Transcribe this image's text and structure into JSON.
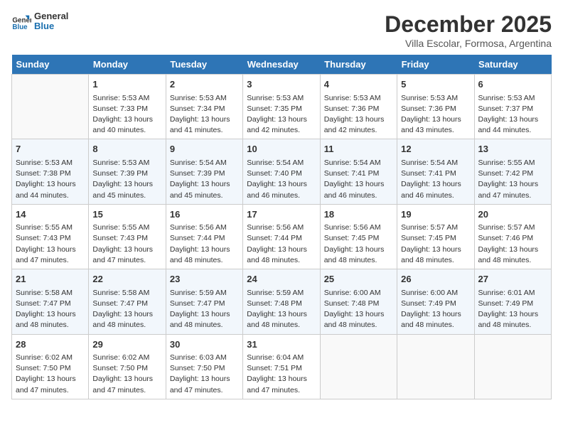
{
  "logo": {
    "text_general": "General",
    "text_blue": "Blue"
  },
  "title": "December 2025",
  "subtitle": "Villa Escolar, Formosa, Argentina",
  "days_of_week": [
    "Sunday",
    "Monday",
    "Tuesday",
    "Wednesday",
    "Thursday",
    "Friday",
    "Saturday"
  ],
  "weeks": [
    [
      {
        "day": "",
        "sunrise": "",
        "sunset": "",
        "daylight": ""
      },
      {
        "day": "1",
        "sunrise": "Sunrise: 5:53 AM",
        "sunset": "Sunset: 7:33 PM",
        "daylight": "Daylight: 13 hours and 40 minutes."
      },
      {
        "day": "2",
        "sunrise": "Sunrise: 5:53 AM",
        "sunset": "Sunset: 7:34 PM",
        "daylight": "Daylight: 13 hours and 41 minutes."
      },
      {
        "day": "3",
        "sunrise": "Sunrise: 5:53 AM",
        "sunset": "Sunset: 7:35 PM",
        "daylight": "Daylight: 13 hours and 42 minutes."
      },
      {
        "day": "4",
        "sunrise": "Sunrise: 5:53 AM",
        "sunset": "Sunset: 7:36 PM",
        "daylight": "Daylight: 13 hours and 42 minutes."
      },
      {
        "day": "5",
        "sunrise": "Sunrise: 5:53 AM",
        "sunset": "Sunset: 7:36 PM",
        "daylight": "Daylight: 13 hours and 43 minutes."
      },
      {
        "day": "6",
        "sunrise": "Sunrise: 5:53 AM",
        "sunset": "Sunset: 7:37 PM",
        "daylight": "Daylight: 13 hours and 44 minutes."
      }
    ],
    [
      {
        "day": "7",
        "sunrise": "Sunrise: 5:53 AM",
        "sunset": "Sunset: 7:38 PM",
        "daylight": "Daylight: 13 hours and 44 minutes."
      },
      {
        "day": "8",
        "sunrise": "Sunrise: 5:53 AM",
        "sunset": "Sunset: 7:39 PM",
        "daylight": "Daylight: 13 hours and 45 minutes."
      },
      {
        "day": "9",
        "sunrise": "Sunrise: 5:54 AM",
        "sunset": "Sunset: 7:39 PM",
        "daylight": "Daylight: 13 hours and 45 minutes."
      },
      {
        "day": "10",
        "sunrise": "Sunrise: 5:54 AM",
        "sunset": "Sunset: 7:40 PM",
        "daylight": "Daylight: 13 hours and 46 minutes."
      },
      {
        "day": "11",
        "sunrise": "Sunrise: 5:54 AM",
        "sunset": "Sunset: 7:41 PM",
        "daylight": "Daylight: 13 hours and 46 minutes."
      },
      {
        "day": "12",
        "sunrise": "Sunrise: 5:54 AM",
        "sunset": "Sunset: 7:41 PM",
        "daylight": "Daylight: 13 hours and 46 minutes."
      },
      {
        "day": "13",
        "sunrise": "Sunrise: 5:55 AM",
        "sunset": "Sunset: 7:42 PM",
        "daylight": "Daylight: 13 hours and 47 minutes."
      }
    ],
    [
      {
        "day": "14",
        "sunrise": "Sunrise: 5:55 AM",
        "sunset": "Sunset: 7:43 PM",
        "daylight": "Daylight: 13 hours and 47 minutes."
      },
      {
        "day": "15",
        "sunrise": "Sunrise: 5:55 AM",
        "sunset": "Sunset: 7:43 PM",
        "daylight": "Daylight: 13 hours and 47 minutes."
      },
      {
        "day": "16",
        "sunrise": "Sunrise: 5:56 AM",
        "sunset": "Sunset: 7:44 PM",
        "daylight": "Daylight: 13 hours and 48 minutes."
      },
      {
        "day": "17",
        "sunrise": "Sunrise: 5:56 AM",
        "sunset": "Sunset: 7:44 PM",
        "daylight": "Daylight: 13 hours and 48 minutes."
      },
      {
        "day": "18",
        "sunrise": "Sunrise: 5:56 AM",
        "sunset": "Sunset: 7:45 PM",
        "daylight": "Daylight: 13 hours and 48 minutes."
      },
      {
        "day": "19",
        "sunrise": "Sunrise: 5:57 AM",
        "sunset": "Sunset: 7:45 PM",
        "daylight": "Daylight: 13 hours and 48 minutes."
      },
      {
        "day": "20",
        "sunrise": "Sunrise: 5:57 AM",
        "sunset": "Sunset: 7:46 PM",
        "daylight": "Daylight: 13 hours and 48 minutes."
      }
    ],
    [
      {
        "day": "21",
        "sunrise": "Sunrise: 5:58 AM",
        "sunset": "Sunset: 7:47 PM",
        "daylight": "Daylight: 13 hours and 48 minutes."
      },
      {
        "day": "22",
        "sunrise": "Sunrise: 5:58 AM",
        "sunset": "Sunset: 7:47 PM",
        "daylight": "Daylight: 13 hours and 48 minutes."
      },
      {
        "day": "23",
        "sunrise": "Sunrise: 5:59 AM",
        "sunset": "Sunset: 7:47 PM",
        "daylight": "Daylight: 13 hours and 48 minutes."
      },
      {
        "day": "24",
        "sunrise": "Sunrise: 5:59 AM",
        "sunset": "Sunset: 7:48 PM",
        "daylight": "Daylight: 13 hours and 48 minutes."
      },
      {
        "day": "25",
        "sunrise": "Sunrise: 6:00 AM",
        "sunset": "Sunset: 7:48 PM",
        "daylight": "Daylight: 13 hours and 48 minutes."
      },
      {
        "day": "26",
        "sunrise": "Sunrise: 6:00 AM",
        "sunset": "Sunset: 7:49 PM",
        "daylight": "Daylight: 13 hours and 48 minutes."
      },
      {
        "day": "27",
        "sunrise": "Sunrise: 6:01 AM",
        "sunset": "Sunset: 7:49 PM",
        "daylight": "Daylight: 13 hours and 48 minutes."
      }
    ],
    [
      {
        "day": "28",
        "sunrise": "Sunrise: 6:02 AM",
        "sunset": "Sunset: 7:50 PM",
        "daylight": "Daylight: 13 hours and 47 minutes."
      },
      {
        "day": "29",
        "sunrise": "Sunrise: 6:02 AM",
        "sunset": "Sunset: 7:50 PM",
        "daylight": "Daylight: 13 hours and 47 minutes."
      },
      {
        "day": "30",
        "sunrise": "Sunrise: 6:03 AM",
        "sunset": "Sunset: 7:50 PM",
        "daylight": "Daylight: 13 hours and 47 minutes."
      },
      {
        "day": "31",
        "sunrise": "Sunrise: 6:04 AM",
        "sunset": "Sunset: 7:51 PM",
        "daylight": "Daylight: 13 hours and 47 minutes."
      },
      {
        "day": "",
        "sunrise": "",
        "sunset": "",
        "daylight": ""
      },
      {
        "day": "",
        "sunrise": "",
        "sunset": "",
        "daylight": ""
      },
      {
        "day": "",
        "sunrise": "",
        "sunset": "",
        "daylight": ""
      }
    ]
  ]
}
